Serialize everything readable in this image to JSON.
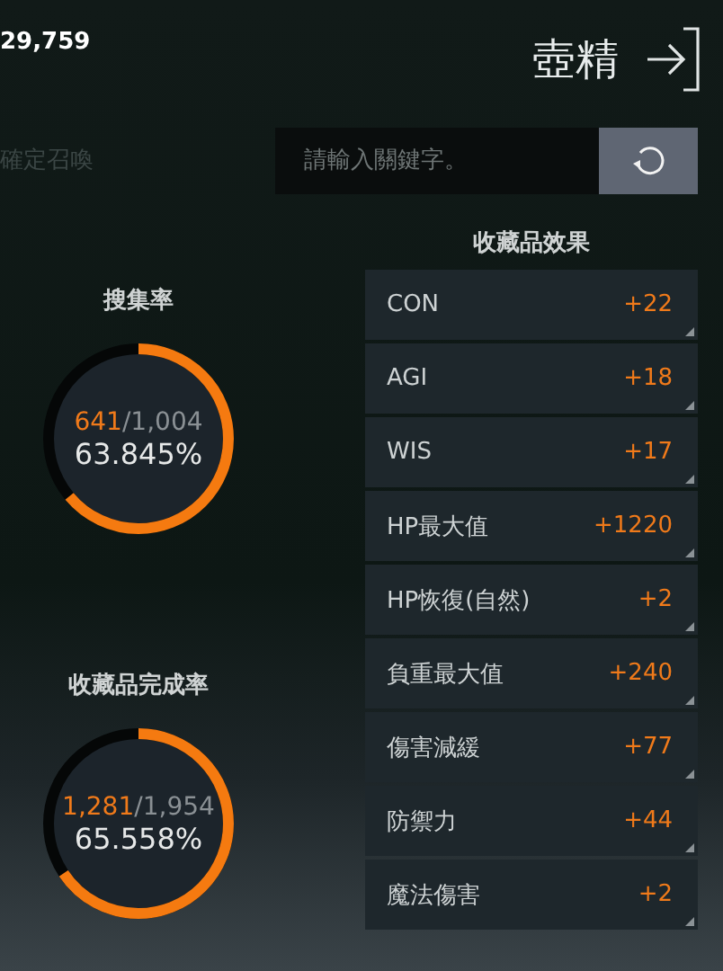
{
  "header": {
    "currency": "29,759",
    "title": "壺精"
  },
  "toolbar": {
    "summon_label": "確定召喚",
    "search": {
      "placeholder": "請輸入關鍵字。"
    }
  },
  "gauges": [
    {
      "title": "搜集率",
      "collected": "641",
      "total": "/1,004",
      "percent": "63.845%",
      "level": 0.63845
    },
    {
      "title": "收藏品完成率",
      "collected": "1,281",
      "total": "/1,954",
      "percent": "65.558%",
      "level": 0.65558
    }
  ],
  "effects": {
    "title": "收藏品效果",
    "rows": [
      {
        "name": "CON",
        "value": "+22"
      },
      {
        "name": "AGI",
        "value": "+18"
      },
      {
        "name": "WIS",
        "value": "+17"
      },
      {
        "name": "HP最大值",
        "value": "+1220"
      },
      {
        "name": "HP恢復(自然)",
        "value": "+2"
      },
      {
        "name": "負重最大值",
        "value": "+240"
      },
      {
        "name": "傷害減緩",
        "value": "+77"
      },
      {
        "name": "防禦力",
        "value": "+44"
      },
      {
        "name": "魔法傷害",
        "value": "+2"
      }
    ]
  }
}
